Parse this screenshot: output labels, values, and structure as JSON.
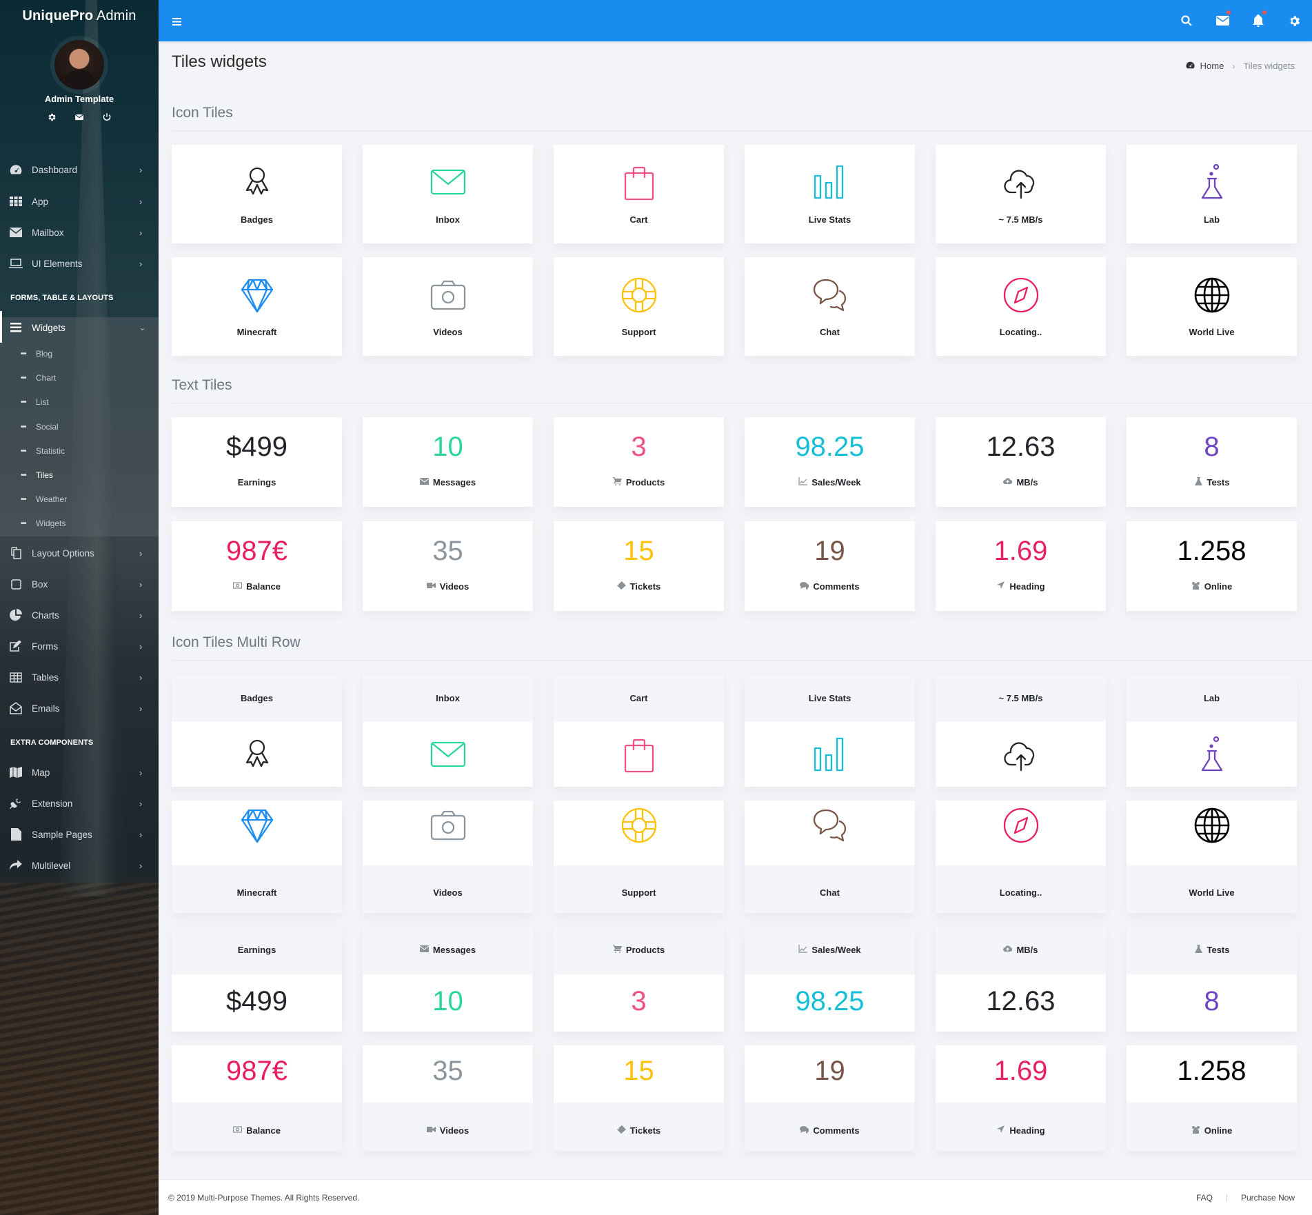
{
  "sidebar": {
    "brand_bold": "UniquePro",
    "brand_light": "Admin",
    "user_name": "Admin Template",
    "user_actions": [
      "gear-icon",
      "envelope-icon",
      "power-icon"
    ],
    "nav": [
      {
        "label": "Dashboard",
        "icon": "dashboard-gauge-icon"
      },
      {
        "label": "App",
        "icon": "grid-apps-icon"
      },
      {
        "label": "Mailbox",
        "icon": "envelope-icon"
      },
      {
        "label": "UI Elements",
        "icon": "laptop-icon"
      }
    ],
    "header1": "FORMS, TABLE & LAYOUTS",
    "widgets": {
      "label": "Widgets",
      "icon": "bars-icon",
      "sub": [
        {
          "label": "Blog"
        },
        {
          "label": "Chart"
        },
        {
          "label": "List"
        },
        {
          "label": "Social"
        },
        {
          "label": "Statistic"
        },
        {
          "label": "Tiles"
        },
        {
          "label": "Weather"
        },
        {
          "label": "Widgets"
        }
      ],
      "current": "Tiles"
    },
    "nav2": [
      {
        "label": "Layout Options",
        "icon": "copy-icon"
      },
      {
        "label": "Box",
        "icon": "square-icon"
      },
      {
        "label": "Charts",
        "icon": "pie-chart-icon"
      },
      {
        "label": "Forms",
        "icon": "edit-icon"
      },
      {
        "label": "Tables",
        "icon": "table-icon"
      },
      {
        "label": "Emails",
        "icon": "envelope-open-icon"
      }
    ],
    "header2": "EXTRA COMPONENTS",
    "nav3": [
      {
        "label": "Map",
        "icon": "map-icon"
      },
      {
        "label": "Extension",
        "icon": "plug-icon"
      },
      {
        "label": "Sample Pages",
        "icon": "file-icon"
      },
      {
        "label": "Multilevel",
        "icon": "share-icon"
      }
    ]
  },
  "topbar": {
    "icons": [
      "search-icon",
      "mail-icon",
      "bell-icon",
      "gear-icon"
    ],
    "notify_dot_color": "#ef5350",
    "bg_color": "#1a8cf0"
  },
  "page": {
    "title": "Tiles widgets",
    "breadcrumb": {
      "home": "Home",
      "current": "Tiles widgets"
    }
  },
  "sections": {
    "icon_tiles": "Icon Tiles",
    "text_tiles": "Text Tiles",
    "multi_row": "Icon Tiles Multi Row"
  },
  "icon_tiles": [
    {
      "label": "Badges",
      "icon": "award-icon",
      "color": "#212529"
    },
    {
      "label": "Inbox",
      "icon": "envelope-icon",
      "color": "#2cd69a"
    },
    {
      "label": "Cart",
      "icon": "shopping-bag-icon",
      "color": "#ef5181"
    },
    {
      "label": "Live Stats",
      "icon": "bar-chart-icon",
      "color": "#17bfd6"
    },
    {
      "label": "~ 7.5 MB/s",
      "icon": "cloud-upload-icon",
      "color": "#212529"
    },
    {
      "label": "Lab",
      "icon": "flask-icon",
      "color": "#6d44c2"
    },
    {
      "label": "Minecraft",
      "icon": "diamond-icon",
      "color": "#1e8cf0"
    },
    {
      "label": "Videos",
      "icon": "camera-icon",
      "color": "#8d959c"
    },
    {
      "label": "Support",
      "icon": "lifebuoy-icon",
      "color": "#ffc107"
    },
    {
      "label": "Chat",
      "icon": "chat-bubbles-icon",
      "color": "#795548"
    },
    {
      "label": "Locating..",
      "icon": "compass-icon",
      "color": "#e91e63"
    },
    {
      "label": "World Live",
      "icon": "globe-icon",
      "color": "#000000"
    }
  ],
  "text_tiles": [
    {
      "value": "$499",
      "label": "Earnings",
      "icon": "",
      "color": "#212529"
    },
    {
      "value": "10",
      "label": "Messages",
      "icon": "envelope-icon",
      "color": "#2cd69a"
    },
    {
      "value": "3",
      "label": "Products",
      "icon": "cart-icon",
      "color": "#ef5181"
    },
    {
      "value": "98.25",
      "label": "Sales/Week",
      "icon": "line-chart-icon",
      "color": "#17bfd6"
    },
    {
      "value": "12.63",
      "label": "MB/s",
      "icon": "cloud-upload-icon",
      "color": "#212529"
    },
    {
      "value": "8",
      "label": "Tests",
      "icon": "flask-icon",
      "color": "#6d44c2"
    },
    {
      "value": "987€",
      "label": "Balance",
      "icon": "money-icon",
      "color": "#e91e63"
    },
    {
      "value": "35",
      "label": "Videos",
      "icon": "video-camera-icon",
      "color": "#8d959c"
    },
    {
      "value": "15",
      "label": "Tickets",
      "icon": "ticket-icon",
      "color": "#ffc107"
    },
    {
      "value": "19",
      "label": "Comments",
      "icon": "comments-icon",
      "color": "#795548"
    },
    {
      "value": "1.69",
      "label": "Heading",
      "icon": "location-arrow-icon",
      "color": "#e91e63"
    },
    {
      "value": "1.258",
      "label": "Online",
      "icon": "users-icon",
      "color": "#000000"
    }
  ],
  "footer": {
    "copyright": "© 2019 Multi-Purpose Themes. All Rights Reserved.",
    "links": [
      "FAQ",
      "Purchase Now"
    ]
  }
}
